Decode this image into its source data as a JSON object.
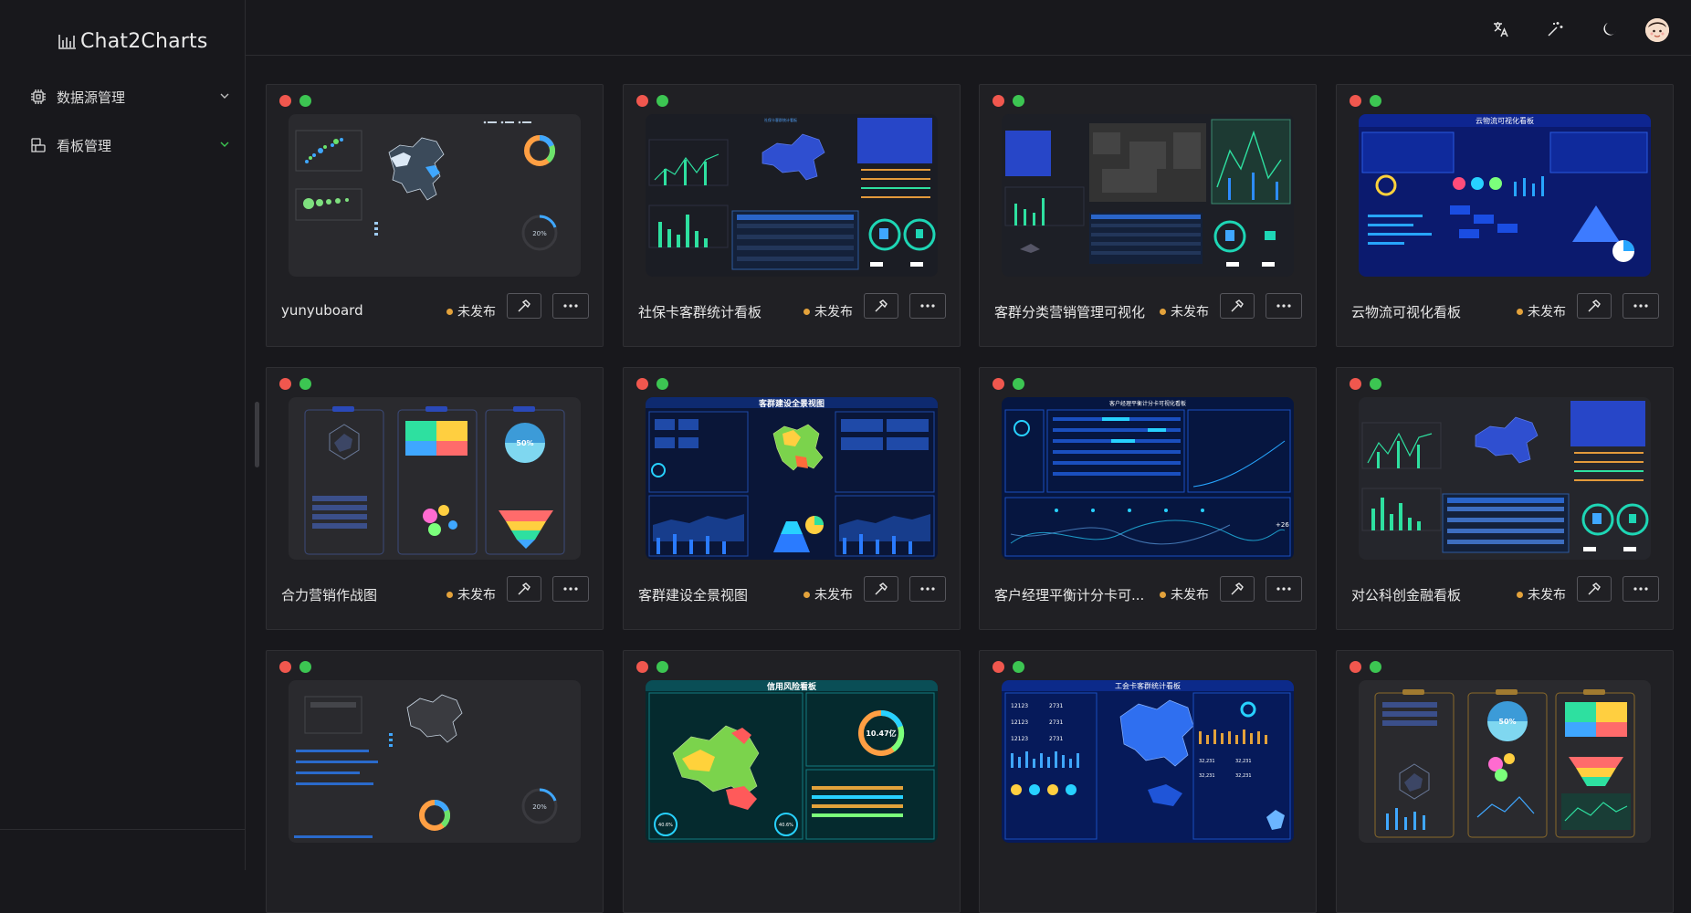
{
  "app": {
    "title": "Chat2Charts"
  },
  "sidebar": {
    "items": [
      {
        "label": "数据源管理"
      },
      {
        "label": "看板管理"
      }
    ]
  },
  "topbar": {
    "icons": [
      "translate-icon",
      "magic-wand-icon",
      "moon-icon",
      "avatar"
    ]
  },
  "cards": [
    {
      "title": "yunyuboard",
      "status": "未发布"
    },
    {
      "title": "社保卡客群统计看板",
      "status": "未发布"
    },
    {
      "title": "客群分类营销管理可视化",
      "status": "未发布"
    },
    {
      "title": "云物流可视化看板",
      "status": "未发布"
    },
    {
      "title": "合力营销作战图",
      "status": "未发布"
    },
    {
      "title": "客群建设全景视图",
      "status": "未发布"
    },
    {
      "title": "客户经理平衡计分卡可...",
      "status": "未发布"
    },
    {
      "title": "对公科创金融看板",
      "status": "未发布"
    },
    {
      "title": "",
      "status": ""
    },
    {
      "title": "",
      "status": ""
    },
    {
      "title": "",
      "status": ""
    },
    {
      "title": "",
      "status": ""
    }
  ],
  "thumbs": {
    "t2": {
      "title": "社保卡客群统计看板"
    },
    "t4": {
      "title": "云物流可视化看板"
    },
    "t6": {
      "title": "客群建设全景视图"
    },
    "t7": {
      "title": "客户经理平衡计分卡可视化看板"
    },
    "t10": {
      "title": "信用风险看板",
      "value": "10.47亿",
      "pct_left": "40.6%",
      "pct_right": "40.6%"
    },
    "t11": {
      "title": "工会卡客群统计看板"
    },
    "t5": {
      "pct": "50%"
    },
    "t12": {
      "pct": "50%"
    },
    "t1": {
      "pct": "20%"
    },
    "t9": {
      "pct": "20%"
    }
  },
  "colors": {
    "status_unpublished": "#e3a23b",
    "accent_green": "#3cc552",
    "accent_red": "#f0574e"
  }
}
